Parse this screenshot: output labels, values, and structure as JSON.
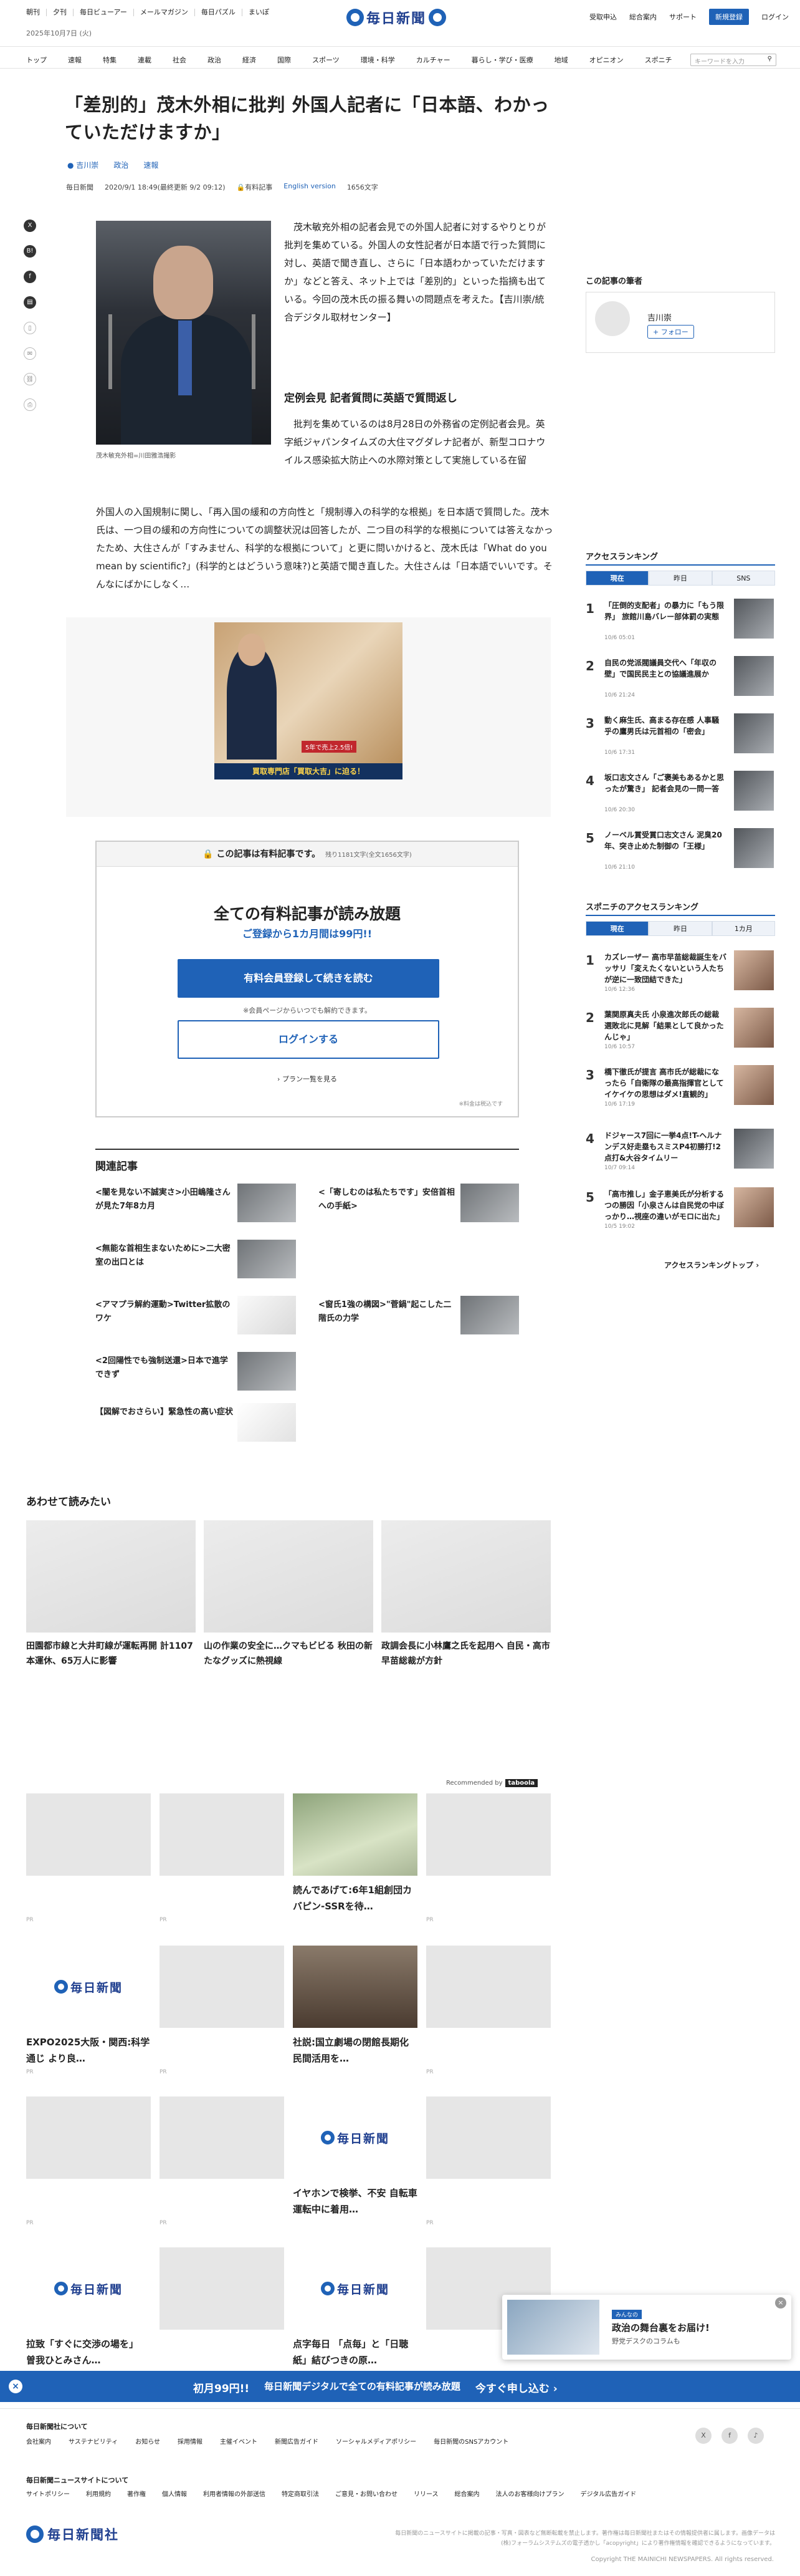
{
  "header": {
    "top_links": [
      "朝刊",
      "夕刊",
      "毎日ビューアー",
      "メールマガジン",
      "毎日パズル",
      "まいぽ"
    ],
    "date": "2025年10月7日 (火)",
    "logo_text": "毎日新聞",
    "right_links": [
      "受取申込",
      "総合案内",
      "サポート"
    ],
    "register_button": "新規登録",
    "login": "ログイン"
  },
  "nav": {
    "items": [
      "トップ",
      "速報",
      "特集",
      "連載",
      "社会",
      "政治",
      "経済",
      "国際",
      "スポーツ",
      "環境・科学",
      "カルチャー",
      "暮らし・学び・医療",
      "地域",
      "オピニオン",
      "スポニチ"
    ],
    "search_placeholder": "キーワードを入力"
  },
  "article": {
    "title": "「差別的」茂木外相に批判 外国人記者に「日本語、わかっていただけますか」",
    "tags": [
      "吉川崇",
      "政治",
      "速報"
    ],
    "meta_source": "毎日新聞",
    "meta_date": "2020/9/1 18:49(最終更新 9/2 09:12)",
    "meta_paid": "有料記事",
    "meta_english": "English version",
    "meta_chars": "1656文字",
    "photo_caption": "茂木敏充外相=川田雅浩撮影",
    "lead": "茂木敏充外相の記者会見での外国人記者に対するやりとりが批判を集めている。外国人の女性記者が日本語で行った質問に対し、英語で聞き直し、さらに「日本語わかっていただけますか」などと答え、ネット上では「差別的」といった指摘も出ている。今回の茂木氏の振る舞いの問題点を考えた。【吉川崇/統合デジタル取材センター】",
    "subheading": "定例会見 記者質問に英語で質問返し",
    "body1": "批判を集めているのは8月28日の外務省の定例記者会見。英字紙ジャパンタイムズの大住マグダレナ記者が、新型コロナウイルス感染拡大防止への水際対策として実施している在留",
    "body2": "外国人の入国規制に関し、「再入国の緩和の方向性と「規制導入の科学的な根拠」を日本語で質問した。茂木氏は、一つ目の緩和の方向性についての調整状況は回答したが、二つ目の科学的な根拠については答えなかったため、大住さんが「すみません、科学的な根拠について」と更に問いかけると、茂木氏は「What do you mean by scientific?」(科学的とはどういう意味?)と英語で聞き直した。大住さんは「日本語でいいです。そんなにばかにしなく…"
  },
  "ad": {
    "band_text": "買取専門店「買取大吉」に迫る！",
    "badge": "5年で売上2.5倍!"
  },
  "paywall": {
    "header": "この記事は有料記事です。",
    "remaining": "残り1181文字(全文1656文字)",
    "headline": "全ての有料記事が読み放題",
    "sub": "ご登録から1カ月間は99円!!",
    "register_button": "有料会員登録して続きを読む",
    "note": "※会員ページからいつでも解約できます。",
    "login_button": "ログインする",
    "plan_link": "プラン一覧を見る",
    "fine": "※料金は税込です"
  },
  "related": {
    "heading": "関連記事",
    "items": [
      "<闇を見ない不誠実さ>小田嶋隆さんが見た7年8カ月",
      "<「寄しむのは私たちです」安倍首相への手紙>",
      "<無能な首相生まないために>二大密室の出口とは",
      "<窗氏1強の構図>\"菅鍋\"起こした二階氏の力学",
      "<アマプラ解約運動>Twitter拡散のワケ",
      "<2回陽性でも強制送還>日本で進学できず",
      "【図解でおさらい】緊急性の高い症状"
    ]
  },
  "read_also": {
    "heading": "あわせて読みたい",
    "items": [
      "田園都市線と大井町線が運転再開 計1107本運休、65万人に影響",
      "山の作業の安全に…クマもビビる 秋田の新たなグッズに熱視線",
      "政調会長に小林鷹之氏を起用へ 自民・高市早苗総裁が方針"
    ]
  },
  "recommend": {
    "label": "Recommended by",
    "brand": "taboola",
    "tiles": [
      {
        "title": "",
        "pr": "PR"
      },
      {
        "title": "",
        "pr": "PR"
      },
      {
        "title": "読んであげて:6年1組創団カバピン-SSRを待…",
        "pr": ""
      },
      {
        "title": "",
        "pr": "PR"
      },
      {
        "title": "EXPO2025大阪・関西:科学通じ より良…",
        "pr": "PR"
      },
      {
        "title": "",
        "pr": "PR"
      },
      {
        "title": "社説:国立劇場の閉館長期化 民間活用を…",
        "pr": ""
      },
      {
        "title": "",
        "pr": "PR"
      },
      {
        "title": "",
        "pr": "PR"
      },
      {
        "title": "",
        "pr": "PR"
      },
      {
        "title": "イヤホンで検挙、不安 自転車運転中に着用…",
        "pr": ""
      },
      {
        "title": "",
        "pr": "PR"
      },
      {
        "title": "拉致「すぐに交渉の場を」 曽我ひとみさん…",
        "pr": ""
      },
      {
        "title": "",
        "pr": "PR"
      },
      {
        "title": "点字毎日 「点毎」と「日聴紙」結びつきの原…",
        "pr": ""
      },
      {
        "title": "",
        "pr": "PR"
      }
    ],
    "logo_text": "毎日新聞"
  },
  "sidebar": {
    "author_heading": "この記事の筆者",
    "author_name": "吉川崇",
    "follow": "+ フォロー",
    "ranking_heading": "アクセスランキング",
    "ranking_tabs": [
      "現在",
      "昨日",
      "SNS"
    ],
    "ranking": [
      {
        "n": "1",
        "t": "「圧倒的支配者」の暴力に「もう限界」 旅館川島バレー部体罰の実態",
        "d": "10/6 05:01"
      },
      {
        "n": "2",
        "t": "自民の党派閥議員交代へ「年収の壁」で国民民主との協議進展か",
        "d": "10/6 21:24"
      },
      {
        "n": "3",
        "t": "動く麻生氏、高まる存在感 人事騒乎の鷹男氏は元首相の「密会」",
        "d": "10/6 17:31"
      },
      {
        "n": "4",
        "t": "坂口志文さん「ご褒美もあるかと思ったが驚き」 記者会見の一問一答",
        "d": "10/6 20:30"
      },
      {
        "n": "5",
        "t": "ノーベル賞受賞口志文さん 泥臭20年、突き止めた制御の「王様」",
        "d": "10/6 21:10"
      }
    ],
    "sponichi_heading": "スポニチのアクセスランキング",
    "sponichi_tabs": [
      "現在",
      "昨日",
      "1カ月"
    ],
    "sponichi": [
      {
        "n": "1",
        "t": "カズレーザー 高市早苗総裁誕生をバッサリ「変えたくないという人たちが逆に一致団結できた」",
        "d": "10/6 12:36"
      },
      {
        "n": "2",
        "t": "葉関原真夫氏 小泉進次郎氏の総裁選敗北に見解「結果として良かったんじゃ」",
        "d": "10/6 10:57"
      },
      {
        "n": "3",
        "t": "橋下徹氏が提言 高市氏が総裁になったら「自衛隊の最高指揮官としてイケイケの思想はダメ!直観的」",
        "d": "10/6 17:19"
      },
      {
        "n": "4",
        "t": "ドジャース7回に一挙4点!T-ヘルナンデス好走塁もスミスP4初勝打!2点打&大谷タイムリー",
        "d": "10/7 09:14"
      },
      {
        "n": "5",
        "t": "「高市推し」金子恵美氏が分析するつの勝因「小泉さんは自民党の中ぼっかり…視座の違いがモロに出た」",
        "d": "10/5 19:02"
      }
    ],
    "ranking_top": "アクセスランキングトップ ›"
  },
  "popup": {
    "tag": "みんなの",
    "title": "政治の舞台裏をお届け!",
    "sub": "野党デスクのコラムも"
  },
  "cta": {
    "close": "×",
    "price": "初月99円!!",
    "text": "毎日新聞デジタルで全ての有料記事が読み放題",
    "action": "今すぐ申し込む ›"
  },
  "footer": {
    "company_heading": "毎日新聞社について",
    "company_links": [
      "会社案内",
      "サステナビリティ",
      "お知らせ",
      "採用情報",
      "主催イベント",
      "新聞広告ガイド",
      "ソーシャルメディアポリシー",
      "毎日新聞のSNSアカウント"
    ],
    "site_heading": "毎日新聞ニュースサイトについて",
    "site_links": [
      "サイトポリシー",
      "利用規約",
      "著作権",
      "個人情報",
      "利用者情報の外部送信",
      "特定商取引法",
      "ご意見・お問い合わせ",
      "リリース",
      "総合案内",
      "法人のお客様向けプラン",
      "デジタル広告ガイド"
    ],
    "logo_text": "毎日新聞社",
    "note": "毎日新聞のニュースサイトに掲載の記事・写真・図表など無断転載を禁止します。著作権は毎日新聞社またはその情報提供者に属します。画像データは(株)フォーラムシステムズの電子透かし「acopyright」により著作権情報を確認できるようになっています。",
    "copyright": "Copyright THE MAINICHI NEWSPAPERS. All rights reserved.",
    "social": [
      "X",
      "f",
      "♪"
    ]
  }
}
